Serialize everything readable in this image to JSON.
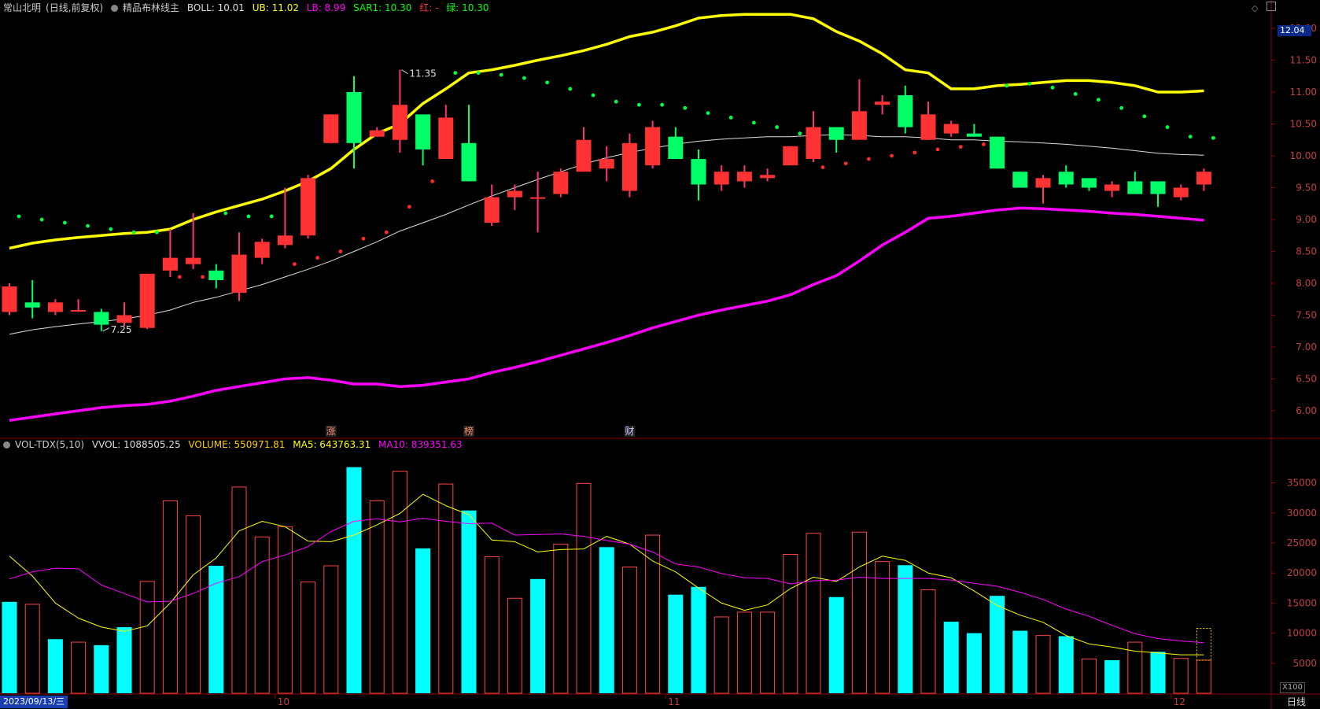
{
  "header": {
    "stock_name": "常山北明",
    "period_note": "(日线,前复权)",
    "indicator_name": "精品布林线主",
    "boll": "BOLL: 10.01",
    "ub": "UB: 11.02",
    "lb": "LB: 8.99",
    "sar1": "SAR1: 10.30",
    "red_label": "红: -",
    "green_label": "绿: 10.30"
  },
  "vol_header": {
    "name": "VOL-TDX(5,10)",
    "vvol": "VVOL: 1088505.25",
    "volume": "VOLUME: 550971.81",
    "ma5": "MA5: 643763.31",
    "ma10": "MA10: 839351.63"
  },
  "current_price_tag": "12.04",
  "x100_label": "X100",
  "footer": {
    "date": "2023/09/13/三",
    "period": "日线"
  },
  "colors": {
    "up": "#ff3333",
    "down": "#00ff66",
    "ub": "#ffff00",
    "lb": "#ff00ff",
    "boll": "#dddddd",
    "vol_up": "#ff4444",
    "vol_down": "#00ffff",
    "ma5": "#ffff00",
    "ma10": "#ff00ff",
    "grid": "#8b0000"
  },
  "chart_data": [
    {
      "type": "candlestick",
      "title": "精品布林线主",
      "ylim": [
        5.75,
        12.25
      ],
      "yticks": [
        "12.00",
        "11.50",
        "11.00",
        "10.50",
        "10.00",
        "9.50",
        "9.00",
        "8.50",
        "8.00",
        "7.50",
        "7.00",
        "6.50",
        "6.00"
      ],
      "x_month_labels": [
        {
          "index": 12,
          "label": "10"
        },
        {
          "index": 29,
          "label": "11"
        },
        {
          "index": 51,
          "label": "12"
        }
      ],
      "annotations": [
        {
          "index": 17,
          "label": "11.35"
        },
        {
          "index": 4,
          "label": "7.25"
        }
      ],
      "event_markers": [
        {
          "index": 14,
          "label": "涨"
        },
        {
          "index": 20,
          "label": "榜"
        },
        {
          "index": 27,
          "label": "财"
        }
      ],
      "series": {
        "ohlc": [
          [
            7.55,
            8.0,
            7.5,
            7.95
          ],
          [
            7.7,
            8.05,
            7.45,
            7.62
          ],
          [
            7.55,
            7.75,
            7.5,
            7.7
          ],
          [
            7.58,
            7.75,
            7.55,
            7.58
          ],
          [
            7.55,
            7.6,
            7.25,
            7.35
          ],
          [
            7.38,
            7.7,
            7.33,
            7.5
          ],
          [
            7.3,
            8.15,
            7.28,
            8.15
          ],
          [
            8.2,
            8.85,
            8.1,
            8.4
          ],
          [
            8.3,
            9.1,
            8.22,
            8.4
          ],
          [
            8.2,
            8.3,
            7.92,
            8.05
          ],
          [
            7.85,
            8.8,
            7.72,
            8.45
          ],
          [
            8.4,
            8.7,
            8.3,
            8.65
          ],
          [
            8.6,
            9.5,
            8.55,
            8.75
          ],
          [
            8.75,
            9.7,
            8.7,
            9.65
          ],
          [
            10.2,
            10.65,
            10.2,
            10.65
          ],
          [
            11.0,
            11.25,
            9.8,
            10.2
          ],
          [
            10.3,
            10.45,
            10.3,
            10.4
          ],
          [
            10.25,
            11.35,
            10.05,
            10.8
          ],
          [
            10.65,
            10.6,
            9.85,
            10.1
          ],
          [
            9.95,
            10.8,
            9.95,
            10.6
          ],
          [
            10.2,
            10.8,
            9.6,
            9.6
          ],
          [
            8.95,
            9.55,
            8.9,
            9.35
          ],
          [
            9.35,
            9.55,
            9.15,
            9.45
          ],
          [
            9.35,
            9.75,
            8.8,
            9.35
          ],
          [
            9.4,
            9.8,
            9.35,
            9.75
          ],
          [
            9.75,
            10.45,
            9.75,
            10.25
          ],
          [
            9.8,
            10.15,
            9.6,
            9.95
          ],
          [
            9.45,
            10.35,
            9.35,
            10.2
          ],
          [
            9.85,
            10.55,
            9.8,
            10.45
          ],
          [
            10.3,
            10.45,
            9.95,
            9.95
          ],
          [
            9.95,
            10.1,
            9.3,
            9.55
          ],
          [
            9.55,
            9.85,
            9.45,
            9.75
          ],
          [
            9.6,
            9.85,
            9.5,
            9.75
          ],
          [
            9.65,
            9.8,
            9.6,
            9.7
          ],
          [
            9.85,
            10.15,
            9.85,
            10.15
          ],
          [
            9.95,
            10.7,
            9.9,
            10.45
          ],
          [
            10.45,
            10.45,
            10.05,
            10.25
          ],
          [
            10.25,
            11.2,
            10.3,
            10.7
          ],
          [
            10.8,
            10.95,
            10.65,
            10.85
          ],
          [
            10.95,
            11.1,
            10.35,
            10.45
          ],
          [
            10.25,
            10.85,
            10.25,
            10.65
          ],
          [
            10.35,
            10.55,
            10.3,
            10.5
          ],
          [
            10.35,
            10.5,
            10.3,
            10.3
          ],
          [
            10.3,
            10.3,
            9.8,
            9.8
          ],
          [
            9.75,
            9.75,
            9.5,
            9.5
          ],
          [
            9.5,
            9.7,
            9.25,
            9.65
          ],
          [
            9.75,
            9.85,
            9.5,
            9.55
          ],
          [
            9.65,
            9.65,
            9.45,
            9.5
          ],
          [
            9.45,
            9.6,
            9.35,
            9.55
          ],
          [
            9.6,
            9.75,
            9.4,
            9.4
          ],
          [
            9.6,
            9.6,
            9.2,
            9.4
          ],
          [
            9.35,
            9.55,
            9.3,
            9.5
          ],
          [
            9.55,
            9.8,
            9.45,
            9.75
          ]
        ],
        "ub": [
          8.55,
          8.63,
          8.68,
          8.72,
          8.75,
          8.78,
          8.8,
          8.85,
          9.0,
          9.12,
          9.22,
          9.32,
          9.45,
          9.6,
          9.8,
          10.1,
          10.35,
          10.5,
          10.82,
          11.05,
          11.3,
          11.35,
          11.42,
          11.5,
          11.57,
          11.65,
          11.75,
          11.87,
          11.94,
          12.04,
          12.16,
          12.2,
          12.22,
          12.22,
          12.22,
          12.15,
          11.95,
          11.8,
          11.6,
          11.35,
          11.3,
          11.05,
          11.05,
          11.1,
          11.12,
          11.15,
          11.18,
          11.18,
          11.15,
          11.1,
          11.0,
          11.0,
          11.02
        ],
        "boll": [
          7.2,
          7.27,
          7.32,
          7.36,
          7.4,
          7.44,
          7.5,
          7.58,
          7.7,
          7.78,
          7.88,
          7.98,
          8.1,
          8.22,
          8.35,
          8.5,
          8.65,
          8.82,
          8.95,
          9.08,
          9.23,
          9.37,
          9.5,
          9.63,
          9.75,
          9.87,
          9.97,
          10.05,
          10.12,
          10.18,
          10.23,
          10.26,
          10.28,
          10.3,
          10.3,
          10.32,
          10.33,
          10.32,
          10.3,
          10.3,
          10.28,
          10.25,
          10.25,
          10.23,
          10.22,
          10.2,
          10.18,
          10.15,
          10.12,
          10.08,
          10.04,
          10.02,
          10.01
        ],
        "lb": [
          5.85,
          5.9,
          5.95,
          6.0,
          6.05,
          6.08,
          6.1,
          6.15,
          6.23,
          6.32,
          6.38,
          6.44,
          6.5,
          6.52,
          6.48,
          6.42,
          6.42,
          6.38,
          6.4,
          6.45,
          6.5,
          6.6,
          6.68,
          6.77,
          6.87,
          6.97,
          7.07,
          7.18,
          7.3,
          7.4,
          7.5,
          7.58,
          7.65,
          7.72,
          7.82,
          7.98,
          8.12,
          8.35,
          8.6,
          8.8,
          9.02,
          9.05,
          9.1,
          9.15,
          9.18,
          9.17,
          9.15,
          9.13,
          9.1,
          9.08,
          9.05,
          9.02,
          8.99
        ],
        "sar": [
          9.05,
          9.0,
          8.95,
          8.9,
          8.85,
          8.8,
          8.8,
          8.1,
          8.1,
          9.1,
          9.05,
          9.05,
          8.3,
          8.4,
          8.5,
          8.7,
          8.8,
          9.2,
          9.6,
          11.3,
          11.3,
          11.27,
          11.22,
          11.15,
          11.05,
          10.95,
          10.85,
          10.8,
          10.8,
          10.75,
          10.67,
          10.6,
          10.52,
          10.45,
          10.35,
          9.82,
          9.88,
          9.95,
          10.0,
          10.05,
          10.1,
          10.14,
          10.18,
          11.1,
          11.13,
          11.07,
          10.97,
          10.88,
          10.75,
          10.62,
          10.45,
          10.3,
          10.28
        ],
        "sar_up": [
          false,
          false,
          false,
          false,
          false,
          false,
          false,
          true,
          true,
          false,
          false,
          false,
          true,
          true,
          true,
          true,
          true,
          true,
          true,
          false,
          false,
          false,
          false,
          false,
          false,
          false,
          false,
          false,
          false,
          false,
          false,
          false,
          false,
          false,
          false,
          true,
          true,
          true,
          true,
          true,
          true,
          true,
          true,
          false,
          false,
          false,
          false,
          false,
          false,
          false,
          false,
          false,
          false
        ]
      }
    },
    {
      "type": "bar",
      "title": "VOL-TDX(5,10)",
      "unit_label": "X100",
      "ylim": [
        0,
        39000
      ],
      "yticks": [
        "35000",
        "30000",
        "25000",
        "20000",
        "15000",
        "10000",
        "5000"
      ],
      "volume": [
        15200,
        14800,
        9000,
        8500,
        8000,
        11000,
        18600,
        32000,
        29500,
        21200,
        34300,
        26000,
        27700,
        18500,
        21200,
        37600,
        32000,
        36900,
        24100,
        34800,
        30400,
        22700,
        15800,
        19000,
        24800,
        34900,
        24300,
        21000,
        26300,
        16400,
        17700,
        12700,
        13500,
        13500,
        23100,
        26600,
        16000,
        26800,
        21900,
        21300,
        17200,
        11900,
        10000,
        16200,
        10400,
        9600,
        9500,
        5700,
        5500,
        8500,
        6900,
        5800,
        5500
      ],
      "volume_up": [
        false,
        true,
        false,
        true,
        false,
        false,
        true,
        true,
        true,
        false,
        true,
        true,
        true,
        true,
        true,
        false,
        true,
        true,
        false,
        true,
        false,
        true,
        true,
        false,
        true,
        true,
        false,
        true,
        true,
        false,
        false,
        true,
        true,
        true,
        true,
        true,
        false,
        true,
        true,
        false,
        true,
        false,
        false,
        false,
        false,
        true,
        false,
        true,
        false,
        true,
        false,
        true,
        true
      ],
      "ma5": [
        22800,
        19500,
        15000,
        12500,
        11000,
        10300,
        11200,
        15000,
        19700,
        22500,
        27000,
        28600,
        27700,
        25300,
        25200,
        26300,
        28000,
        29900,
        33100,
        31200,
        29700,
        25500,
        25200,
        23500,
        23900,
        24000,
        26100,
        24800,
        22000,
        20200,
        17500,
        15000,
        13800,
        14700,
        17400,
        19300,
        18600,
        21000,
        22800,
        22100,
        20000,
        19200,
        17000,
        14600,
        13000,
        11800,
        9600,
        8200,
        7700,
        7000,
        6700,
        6400,
        6400
      ],
      "ma10": [
        19000,
        20200,
        20800,
        20700,
        18000,
        16600,
        15200,
        15300,
        16600,
        18300,
        19400,
        21900,
        23000,
        24400,
        26900,
        28600,
        29000,
        28500,
        29100,
        28600,
        28200,
        28300,
        26300,
        26400,
        26500,
        26100,
        25400,
        24800,
        23500,
        21500,
        21000,
        19900,
        19200,
        19100,
        18200,
        18700,
        18800,
        19300,
        19100,
        19100,
        19100,
        18800,
        18300,
        17800,
        16800,
        15600,
        14000,
        12800,
        11300,
        9900,
        9100,
        8700,
        8400
      ]
    }
  ]
}
